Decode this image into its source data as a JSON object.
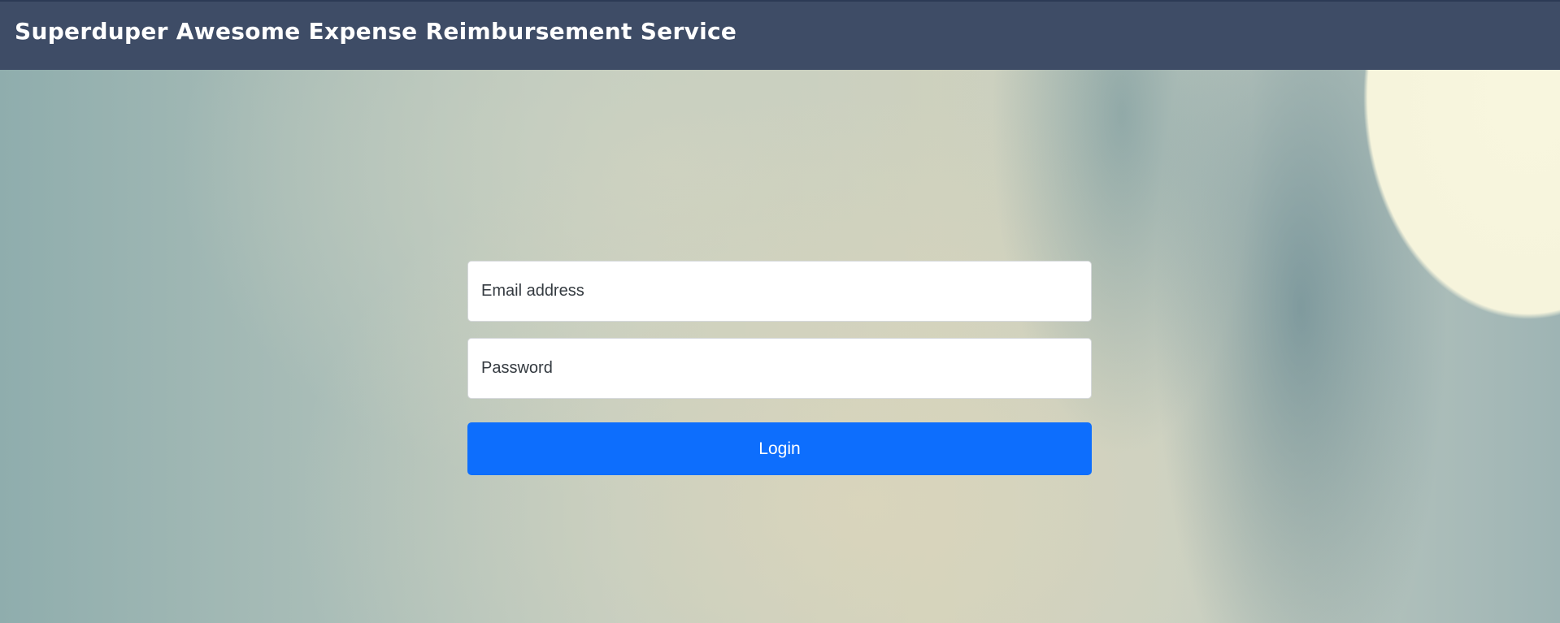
{
  "header": {
    "title": "Superduper Awesome Expense Reimbursement Service"
  },
  "login_form": {
    "email": {
      "value": "",
      "placeholder": "Email address"
    },
    "password": {
      "value": "",
      "placeholder": "Password"
    },
    "submit_label": "Login"
  },
  "colors": {
    "navbar": "#3e4c66",
    "primary_button": "#0d6efd",
    "field_background": "#ffffff"
  }
}
